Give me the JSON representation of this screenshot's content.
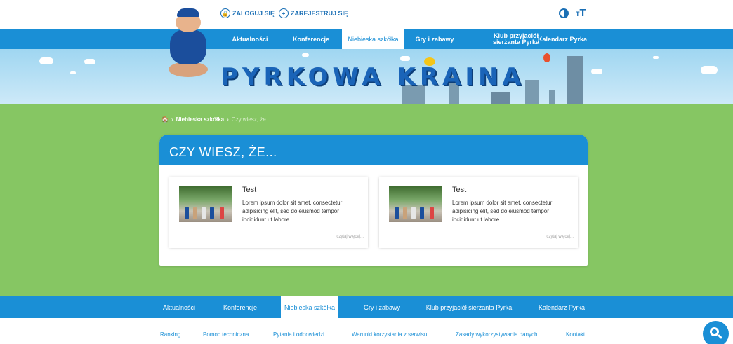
{
  "header": {
    "login_label": "ZALOGUJ SIĘ",
    "register_label": "ZAREJESTRUJ SIĘ"
  },
  "main_nav": {
    "items": [
      "Aktualności",
      "Konferencje",
      "Niebieska szkółka",
      "Gry i zabawy",
      "Klub przyjaciół sierżanta Pyrka",
      "Kalendarz Pyrka"
    ],
    "active": "Niebieska szkółka"
  },
  "banner": {
    "title": "PYRKOWA KRAINA"
  },
  "breadcrumb": {
    "section": "Niebieska szkółka",
    "current": "Czy wiesz, że..."
  },
  "section": {
    "title": "CZY WIESZ, ŻE..."
  },
  "articles": [
    {
      "title": "Test",
      "text": "Lorem ipsum dolor sit amet, consectetur adipisicing elit, sed do eiusmod tempor incididunt ut labore...",
      "more": "czytaj więcej..."
    },
    {
      "title": "Test",
      "text": "Lorem ipsum dolor sit amet, consectetur adipisicing elit, sed do eiusmod tempor incididunt ut labore...",
      "more": "czytaj więcej..."
    }
  ],
  "bottom_nav": {
    "items": [
      "Aktualności",
      "Konferencje",
      "Niebieska szkółka",
      "Gry i zabawy",
      "Klub przyjaciół sierżanta Pyrka",
      "Kalendarz Pyrka"
    ],
    "active": "Niebieska szkółka"
  },
  "footer_links": [
    "Ranking",
    "Pomoc techniczna",
    "Pytania i odpowiedzi",
    "Warunki korzystania z serwisu",
    "Zasady wykorzystywania danych",
    "Kontakt"
  ],
  "colors": {
    "primary_blue": "#1a8fd6",
    "grass_green": "#86c663",
    "title_blue": "#1a64b8"
  },
  "icons": {
    "login": "lock-icon",
    "register": "user-add-icon",
    "contrast": "contrast-icon",
    "font_size": "font-size-icon",
    "home": "home-icon",
    "search": "search-icon"
  }
}
